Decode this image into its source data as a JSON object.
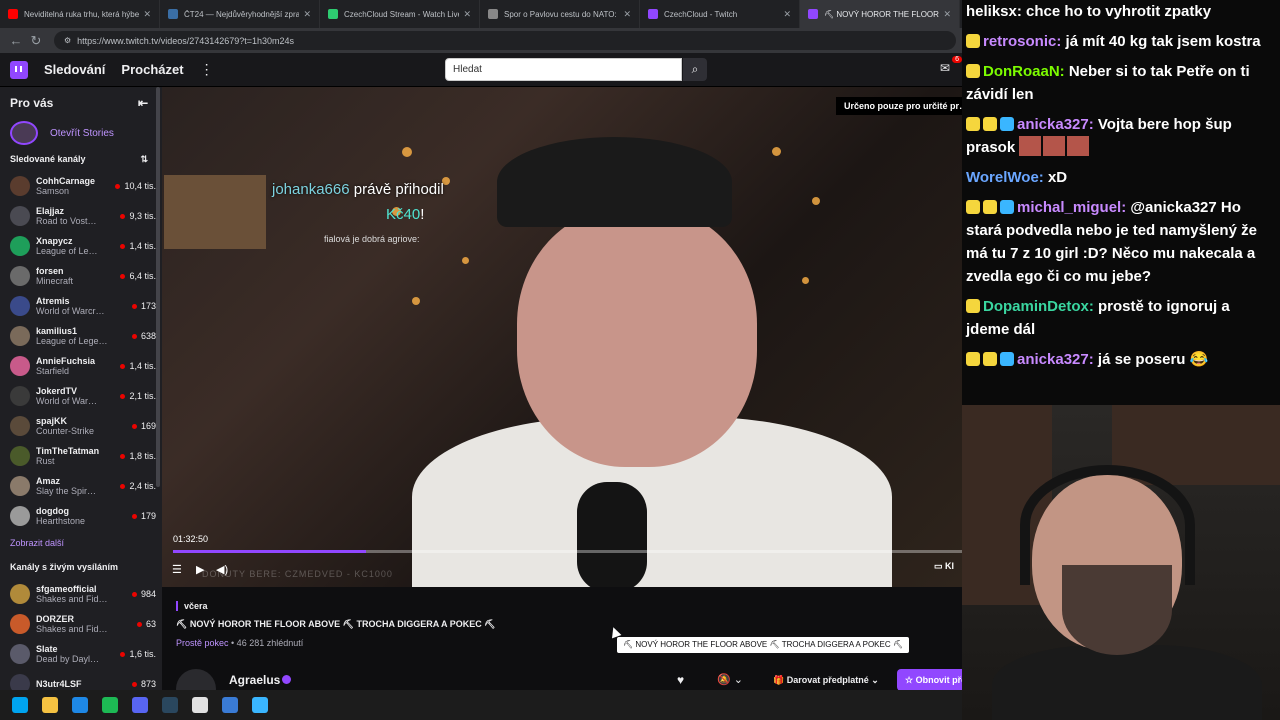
{
  "browser": {
    "tabs": [
      {
        "title": "Neviditelná ruka trhu, která hýbe …",
        "color": "#ff0000"
      },
      {
        "title": "ČT24 — Nejdůvěryhodnější zpravo…",
        "color": "#3a6ea5"
      },
      {
        "title": "CzechCloud Stream - Watch Live …",
        "color": "#2ecc71"
      },
      {
        "title": "Spor o Pavlovu cestu do NATO: „J…",
        "color": "#888888"
      },
      {
        "title": "CzechCloud - Twitch",
        "color": "#9147ff"
      },
      {
        "title": "⛏ NOVÝ HOROR THE FLOOR ABO…",
        "color": "#9147ff"
      }
    ],
    "url": "https://www.twitch.tv/videos/2743142679?t=1h30m24s"
  },
  "twitch_nav": {
    "following": "Sledování",
    "browse": "Procházet",
    "more": "⋮",
    "search_placeholder": "Hledat",
    "inbox_count": "6"
  },
  "sidebar": {
    "for_you": "Pro vás",
    "collapse": "⇤",
    "stories": "Otevřít Stories",
    "followed_heading": "Sledované kanály",
    "sort_icon": "⇅",
    "followed": [
      {
        "name": "CohhCarnage",
        "game": "Samson",
        "viewers": "10,4 tis.",
        "color": "#5a3c2e"
      },
      {
        "name": "Elajjaz",
        "game": "Road to Vost…",
        "viewers": "9,3 tis.",
        "color": "#4a4a52"
      },
      {
        "name": "Xnapycz",
        "game": "League of Le…",
        "viewers": "1,4 tis.",
        "color": "#1e9e5a"
      },
      {
        "name": "forsen",
        "game": "Minecraft",
        "viewers": "6,4 tis.",
        "color": "#6a6a6a"
      },
      {
        "name": "Atremis",
        "game": "World of Warcr…",
        "viewers": "173",
        "color": "#3a4a8a"
      },
      {
        "name": "kamilius1",
        "game": "League of Lege…",
        "viewers": "638",
        "color": "#7a6a5a"
      },
      {
        "name": "AnnieFuchsia",
        "game": "Starfield",
        "viewers": "1,4 tis.",
        "color": "#c85a8a"
      },
      {
        "name": "JokerdTV",
        "game": "World of War…",
        "viewers": "2,1 tis.",
        "color": "#3a3a3a"
      },
      {
        "name": "spajKK",
        "game": "Counter-Strike",
        "viewers": "169",
        "color": "#5a4a3a"
      },
      {
        "name": "TimTheTatman",
        "game": "Rust",
        "viewers": "1,8 tis.",
        "color": "#4a5a2a"
      },
      {
        "name": "Amaz",
        "game": "Slay the Spir…",
        "viewers": "2,4 tis.",
        "color": "#8a7a6a"
      },
      {
        "name": "dogdog",
        "game": "Hearthstone",
        "viewers": "179",
        "color": "#9a9a9a"
      }
    ],
    "show_more": "Zobrazit další",
    "live_heading": "Kanály s živým vysíláním",
    "live": [
      {
        "name": "sfgameofficial",
        "game": "Shakes and Fid…",
        "viewers": "984",
        "color": "#b08a3a"
      },
      {
        "name": "DORZER",
        "game": "Shakes and Fid…",
        "viewers": "63",
        "color": "#c85a2a"
      },
      {
        "name": "Slate",
        "game": "Dead by Dayl…",
        "viewers": "1,6 tis.",
        "color": "#5a5a6a"
      },
      {
        "name": "N3utr4LSF",
        "game": "",
        "viewers": "873",
        "color": "#3a3a4a"
      }
    ]
  },
  "player": {
    "alert_user": "johanka666",
    "alert_action": " právě přihodil",
    "alert_amount": "Kč40",
    "alert_bang": "!",
    "alert_message": "fialová je dobrá agriove:",
    "sub_only": "Určeno pouze pro určité pr…",
    "timecode": "01:32:50",
    "progress_fraction": 0.245,
    "watermark": "DONUTY BERE: CZMEDVED - KC1000",
    "clip": "Kl"
  },
  "video_info": {
    "date": "včera",
    "title": "⛏ NOVÝ HOROR THE FLOOR ABOVE ⛏ TROCHA DIGGERA A POKEC ⛏",
    "category": "Prostě pokec",
    "views": " • 46 281 zhlédnutí",
    "tooltip": "⛏ NOVÝ HOROR THE FLOOR ABOVE ⛏ TROCHA DIGGERA A POKEC ⛏",
    "channel": "Agraelus",
    "gift_sub": "Darovat předplatné",
    "renew": "☆ Obnovit předplatné"
  },
  "chat": [
    {
      "user": "heliksx",
      "color": "#ffffff",
      "text": "chce ho to vyhrotit zpatky",
      "badges": []
    },
    {
      "user": "retrosonic",
      "color": "#c88aff",
      "text": "já mít 40 kg tak jsem kostra",
      "badges": [
        "#f5d63d"
      ]
    },
    {
      "user": "DonRoaaN",
      "color": "#7cfc00",
      "text": "Neber si to tak Petře on ti závidí len",
      "badges": [
        "#f5d63d"
      ]
    },
    {
      "user": "anicka327",
      "color": "#c88aff",
      "text": "Vojta bere hop šup prasok",
      "badges": [
        "#f5d63d",
        "#f5d63d",
        "#3ab6ff"
      ],
      "emotes": 3
    },
    {
      "user": "WorelWoe",
      "color": "#6aa6ff",
      "text": "xD",
      "badges": []
    },
    {
      "user": "michal_miguel",
      "color": "#c88aff",
      "text": "@anicka327 Ho stará podvedla nebo je ted namyšlený že má tu 7 z 10 girl :D? Něco mu nakecala a zvedla ego či co mu jebe?",
      "badges": [
        "#f5d63d",
        "#f5d63d",
        "#3ab6ff"
      ]
    },
    {
      "user": "DopaminDetox",
      "color": "#3ad6a0",
      "text": "prostě to ignoruj a jdeme dál",
      "badges": [
        "#f5d63d"
      ]
    },
    {
      "user": "anicka327",
      "color": "#c88aff",
      "text": "já se poseru 😂",
      "badges": [
        "#f5d63d",
        "#f5d63d",
        "#3ab6ff"
      ]
    }
  ],
  "taskbar": [
    "#00a4ef",
    "#f5c242",
    "#1e88e5",
    "#1db954",
    "#5865f2",
    "#2a475e",
    "#e0e0e0",
    "#3a7bd5",
    "#3ab6ff"
  ]
}
